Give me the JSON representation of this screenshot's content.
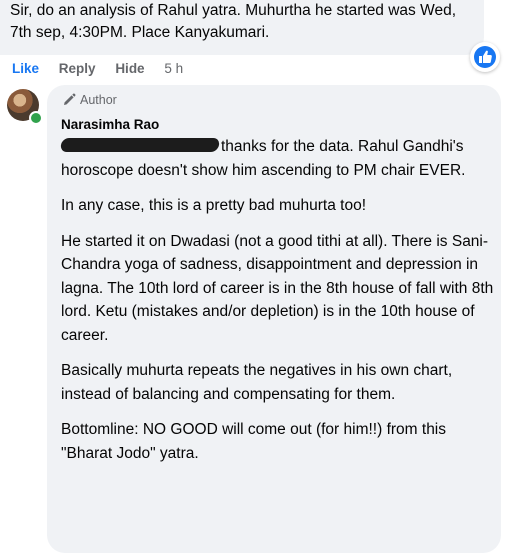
{
  "parent_comment": {
    "text": "Sir, do an analysis of Rahul yatra. Muhurtha he started was Wed, 7th sep, 4:30PM. Place Kanyakumari."
  },
  "actions": {
    "like": "Like",
    "reply": "Reply",
    "hide": "Hide",
    "time": "5 h"
  },
  "reaction": {
    "icon": "thumbs-up-icon",
    "color": "#1877f2"
  },
  "reply_comment": {
    "badge": "Author",
    "author": "Narasimha Rao",
    "p1": "thanks for the data. Rahul Gandhi's horoscope doesn't show him ascending to PM chair EVER.",
    "p2": "In any case, this is a pretty bad muhurta too!",
    "p3": "He started it on Dwadasi (not a good tithi at all). There is Sani-Chandra yoga of sadness, disappointment and depression in lagna. The 10th lord of career is in the 8th house of fall with 8th lord. Ketu (mistakes and/or depletion) is in the 10th house of career.",
    "p4": "Basically muhurta repeats the negatives in his own chart, instead of balancing and compensating for them.",
    "p5": "Bottomline: NO GOOD will come out (for him!!) from this \"Bharat Jodo\" yatra."
  }
}
